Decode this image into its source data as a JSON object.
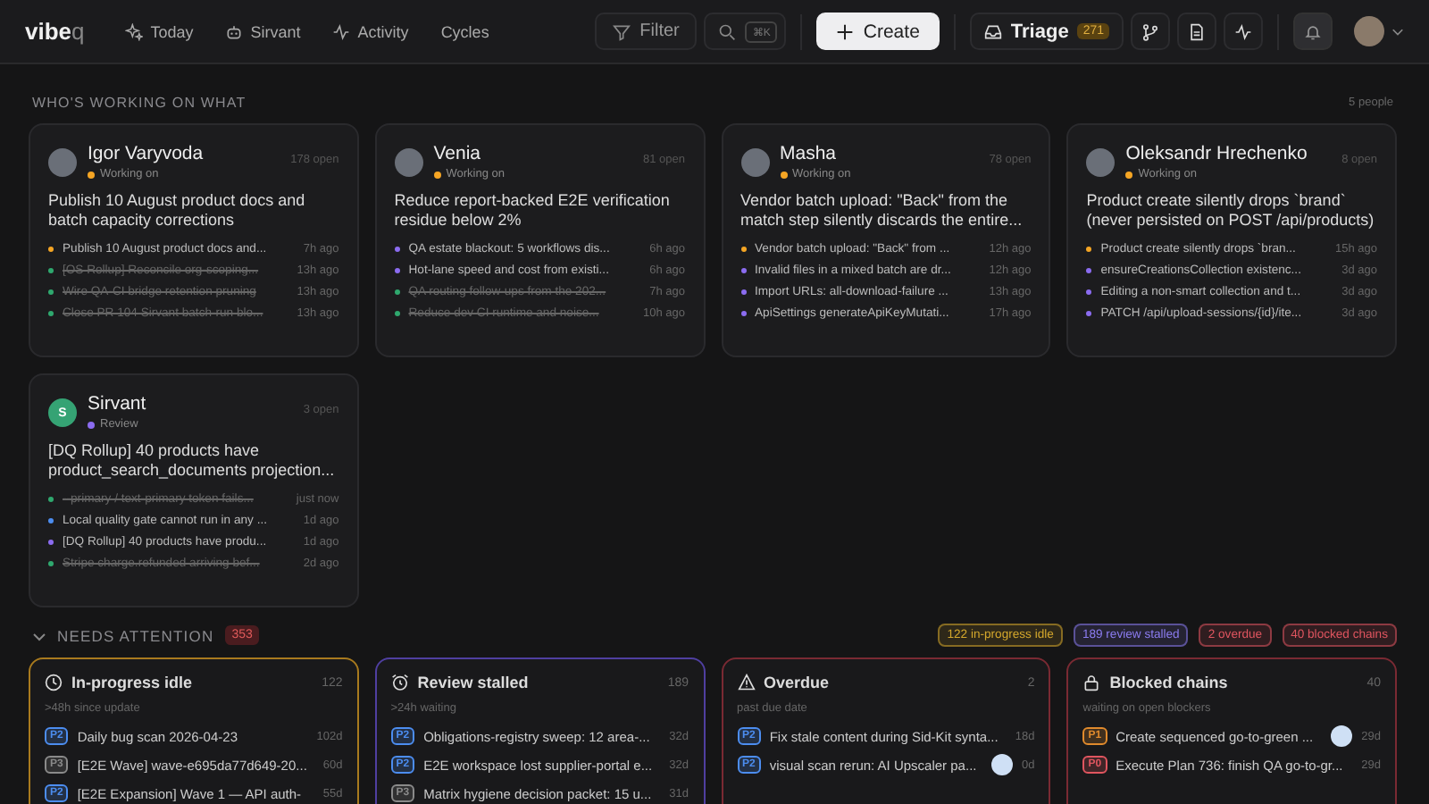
{
  "nav": {
    "logo": "vibe",
    "logo_suffix": "q",
    "items": [
      {
        "label": "Today",
        "kind": "sparkle"
      },
      {
        "label": "Sirvant",
        "kind": "robot"
      },
      {
        "label": "Activity",
        "kind": "pulse"
      },
      {
        "label": "Cycles",
        "kind": "none"
      }
    ],
    "filter": "Filter",
    "search_shortcut": "⌘K",
    "create": "Create",
    "triage": {
      "label": "Triage",
      "count": "271"
    },
    "notifications": {
      "selected": true
    }
  },
  "working": {
    "title": "WHO'S WORKING ON WHAT",
    "count": "5 people",
    "people": [
      {
        "name": "Igor Varyvoda",
        "status": {
          "label": "Working on",
          "color": "#f5a524"
        },
        "open": "178 open",
        "title": "Publish 10 August product docs and batch capacity corrections",
        "tasks": [
          {
            "text": "Publish 10 August product docs and...",
            "time": "7h ago",
            "color": "#f5a524",
            "done": false
          },
          {
            "text": "[OS Rollup] Reconcile org-scoping...",
            "time": "13h ago",
            "color": "#2fa86e",
            "done": true
          },
          {
            "text": "Wire QA-CI bridge retention pruning",
            "time": "13h ago",
            "color": "#2fa86e",
            "done": true
          },
          {
            "text": "Close PR 104 Sirvant batch-run blo...",
            "time": "13h ago",
            "color": "#2fa86e",
            "done": true
          }
        ]
      },
      {
        "name": "Venia",
        "status": {
          "label": "Working on",
          "color": "#f5a524"
        },
        "open": "81 open",
        "title": "Reduce report-backed E2E verification residue below 2%",
        "tasks": [
          {
            "text": "QA estate blackout: 5 workflows dis...",
            "time": "6h ago",
            "color": "#8b6cf0",
            "done": false
          },
          {
            "text": "Hot-lane speed and cost from existi...",
            "time": "6h ago",
            "color": "#8b6cf0",
            "done": false
          },
          {
            "text": "QA routing follow-ups from the 202...",
            "time": "7h ago",
            "color": "#2fa86e",
            "done": true
          },
          {
            "text": "Reduce dev CI runtime and noise...",
            "time": "10h ago",
            "color": "#2fa86e",
            "done": true
          }
        ]
      },
      {
        "name": "Masha",
        "status": {
          "label": "Working on",
          "color": "#f5a524"
        },
        "open": "78 open",
        "title": "Vendor batch upload: \"Back\" from the match step silently discards the entire...",
        "tasks": [
          {
            "text": "Vendor batch upload: \"Back\" from ...",
            "time": "12h ago",
            "color": "#f5a524",
            "done": false
          },
          {
            "text": "Invalid files in a mixed batch are dr...",
            "time": "12h ago",
            "color": "#8b6cf0",
            "done": false
          },
          {
            "text": "Import URLs: all-download-failure ...",
            "time": "13h ago",
            "color": "#8b6cf0",
            "done": false
          },
          {
            "text": "ApiSettings generateApiKeyMutati...",
            "time": "17h ago",
            "color": "#8b6cf0",
            "done": false
          }
        ]
      },
      {
        "name": "Oleksandr Hrechenko",
        "status": {
          "label": "Working on",
          "color": "#f5a524"
        },
        "open": "8 open",
        "title": "Product create silently drops `brand` (never persisted on POST /api/products)",
        "tasks": [
          {
            "text": "Product create silently drops `bran...",
            "time": "15h ago",
            "color": "#f5a524",
            "done": false
          },
          {
            "text": "ensureCreationsCollection existenc...",
            "time": "3d ago",
            "color": "#8b6cf0",
            "done": false
          },
          {
            "text": "Editing a non-smart collection and t...",
            "time": "3d ago",
            "color": "#8b6cf0",
            "done": false
          },
          {
            "text": "PATCH /api/upload-sessions/{id}/ite...",
            "time": "3d ago",
            "color": "#8b6cf0",
            "done": false
          }
        ]
      },
      {
        "name": "Sirvant",
        "avatar_letter": "S",
        "status": {
          "label": "Review",
          "color": "#8b6cf0"
        },
        "open": "3 open",
        "title": "[DQ Rollup] 40 products have product_search_documents projection...",
        "tasks": [
          {
            "text": "--primary / text-primary token fails...",
            "time": "just now",
            "color": "#2fa86e",
            "done": true
          },
          {
            "text": "Local quality gate cannot run in any ...",
            "time": "1d ago",
            "color": "#4c8df0",
            "done": false
          },
          {
            "text": "[DQ Rollup] 40 products have produ...",
            "time": "1d ago",
            "color": "#8b6cf0",
            "done": false
          },
          {
            "text": "Stripe charge.refunded arriving bef...",
            "time": "2d ago",
            "color": "#2fa86e",
            "done": true
          }
        ]
      }
    ]
  },
  "attention": {
    "title": "NEEDS ATTENTION",
    "count": "353",
    "expanded": true,
    "chips": [
      {
        "label": "122 in-progress idle",
        "color": "#d4a72c"
      },
      {
        "label": "189 review stalled",
        "color": "#8b7cf0"
      },
      {
        "label": "2 overdue",
        "color": "#e0555f"
      },
      {
        "label": "40 blocked chains",
        "color": "#e0555f"
      }
    ],
    "groups": [
      {
        "kind": "idle",
        "title": "In-progress idle",
        "count": "122",
        "subtitle": ">48h since update",
        "color": "#a87a1e",
        "items": [
          {
            "priority": {
              "label": "P2",
              "color": "#4c8df0"
            },
            "text": "Daily bug scan 2026-04-23",
            "age": "102d",
            "assignee": false
          },
          {
            "priority": {
              "label": "P3",
              "color": "#8a8a8a"
            },
            "text": "[E2E Wave] wave-e695da77d649-20...",
            "age": "60d",
            "assignee": false
          },
          {
            "priority": {
              "label": "P2",
              "color": "#4c8df0"
            },
            "text": "[E2E Expansion] Wave 1 — API auth-",
            "age": "55d",
            "assignee": false
          }
        ]
      },
      {
        "kind": "stalled",
        "title": "Review stalled",
        "count": "189",
        "subtitle": ">24h waiting",
        "color": "#4f3fa0",
        "items": [
          {
            "priority": {
              "label": "P2",
              "color": "#4c8df0"
            },
            "text": "Obligations-registry sweep: 12 area-...",
            "age": "32d",
            "assignee": false
          },
          {
            "priority": {
              "label": "P2",
              "color": "#4c8df0"
            },
            "text": "E2E workspace lost supplier-portal e...",
            "age": "32d",
            "assignee": false
          },
          {
            "priority": {
              "label": "P3",
              "color": "#8a8a8a"
            },
            "text": "Matrix hygiene decision packet: 15 u...",
            "age": "31d",
            "assignee": false
          }
        ]
      },
      {
        "kind": "overdue",
        "title": "Overdue",
        "count": "2",
        "subtitle": "past due date",
        "color": "#7a2a33",
        "items": [
          {
            "priority": {
              "label": "P2",
              "color": "#4c8df0"
            },
            "text": "Fix stale content during Sid-Kit synta...",
            "age": "18d",
            "assignee": false
          },
          {
            "priority": {
              "label": "P2",
              "color": "#4c8df0"
            },
            "text": "visual scan rerun: AI Upscaler pa...",
            "age": "0d",
            "assignee": true
          }
        ]
      },
      {
        "kind": "blocked",
        "title": "Blocked chains",
        "count": "40",
        "subtitle": "waiting on open blockers",
        "color": "#7a2a33",
        "items": [
          {
            "priority": {
              "label": "P1",
              "color": "#e08a2c"
            },
            "text": "Create sequenced go-to-green ...",
            "age": "29d",
            "assignee": true
          },
          {
            "priority": {
              "label": "P0",
              "color": "#e0555f"
            },
            "text": "Execute Plan 736: finish QA go-to-gr...",
            "age": "29d",
            "assignee": false
          }
        ]
      }
    ]
  }
}
